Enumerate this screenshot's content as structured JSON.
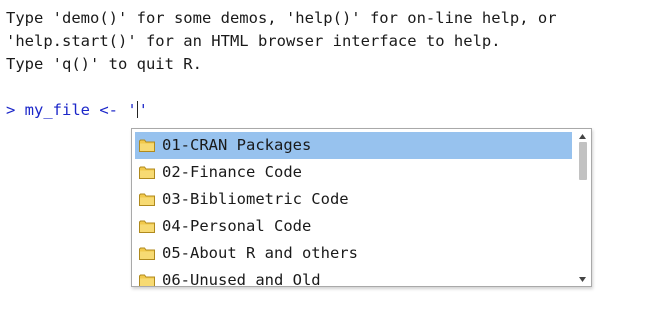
{
  "console": {
    "intro_lines": [
      "Type 'demo()' for some demos, 'help()' for on-line help, or",
      "'help.start()' for an HTML browser interface to help.",
      "Type 'q()' to quit R."
    ],
    "prompt": "> my_file <- '",
    "closing_quote": "'",
    "prompt_color": "#1c27c9"
  },
  "completion_popup": {
    "items": [
      {
        "icon": "folder-icon",
        "label": "01-CRAN Packages",
        "selected": true
      },
      {
        "icon": "folder-icon",
        "label": "02-Finance Code",
        "selected": false
      },
      {
        "icon": "folder-icon",
        "label": "03-Bibliometric Code",
        "selected": false
      },
      {
        "icon": "folder-icon",
        "label": "04-Personal Code",
        "selected": false
      },
      {
        "icon": "folder-icon",
        "label": "05-About R and others",
        "selected": false
      },
      {
        "icon": "folder-icon",
        "label": "06-Unused and Old",
        "selected": false
      }
    ],
    "selection_color": "#97c2ee",
    "scrollbar": {
      "up_icon": "scroll-up-arrow-icon",
      "down_icon": "scroll-down-arrow-icon"
    }
  }
}
